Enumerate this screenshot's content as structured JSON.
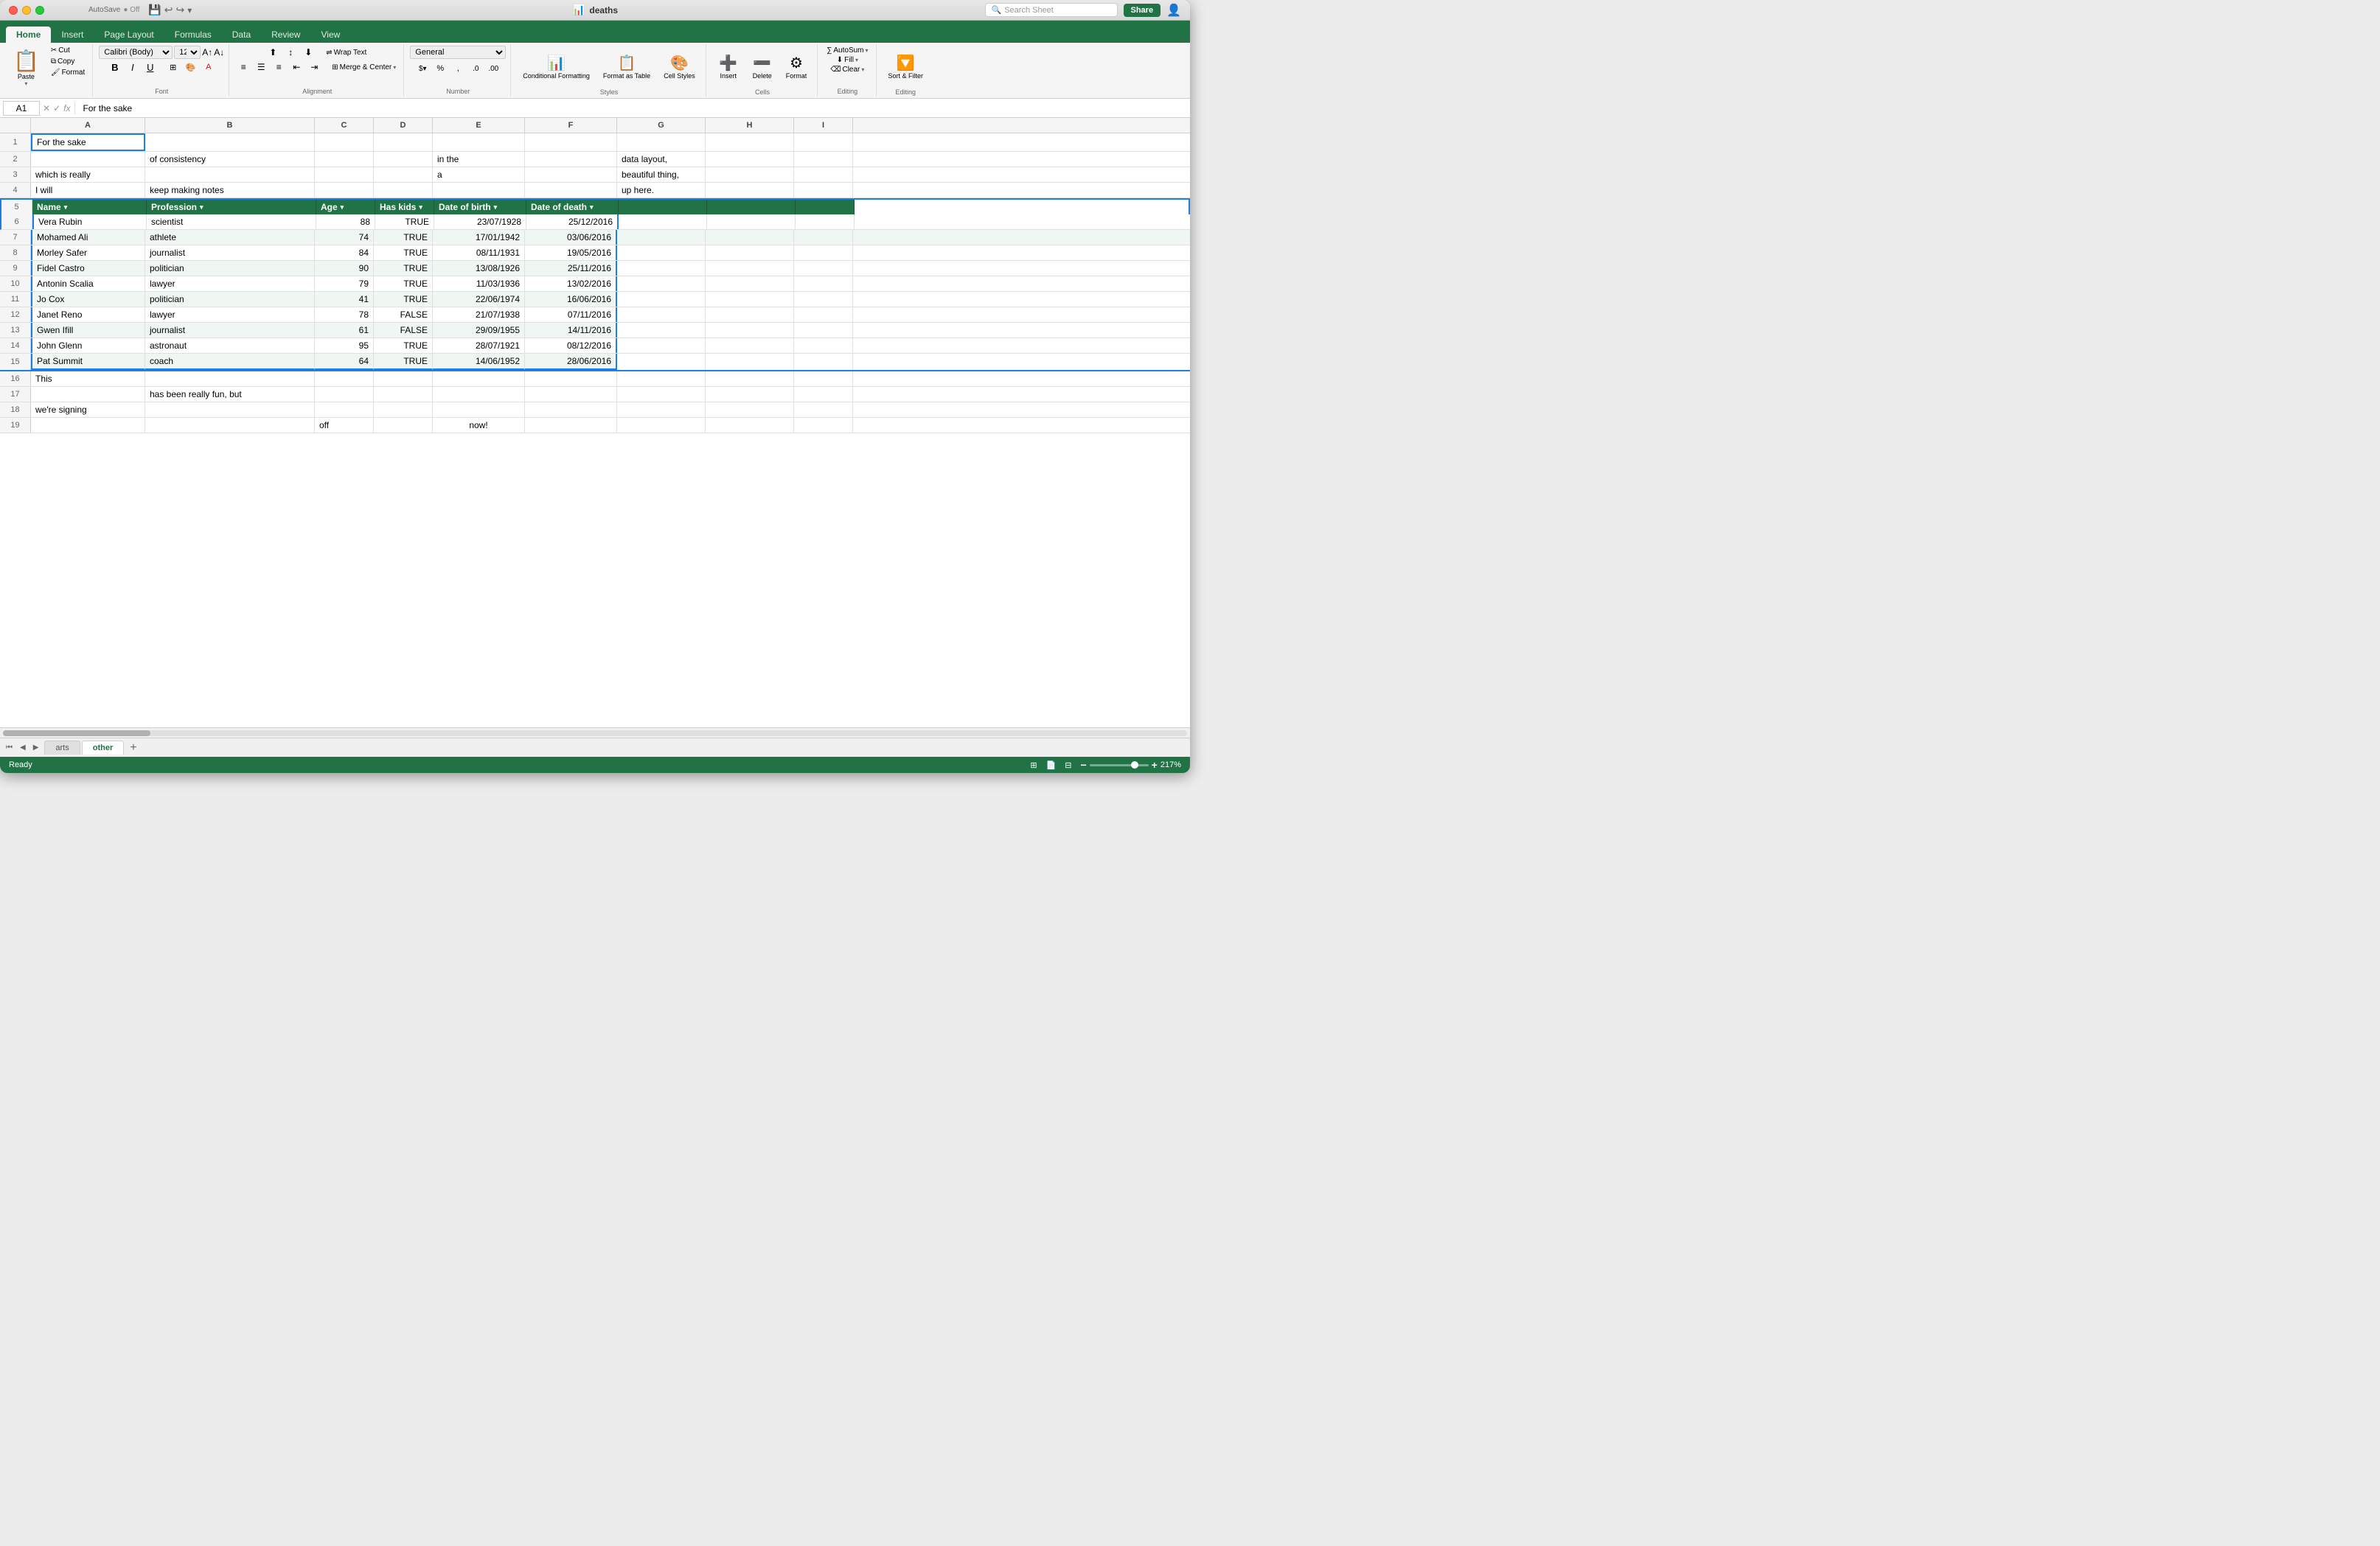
{
  "window": {
    "title": "deaths",
    "autosave": "AutoSave",
    "autosave_status": "Off"
  },
  "titlebar": {
    "search_placeholder": "Search Sheet",
    "share_label": "Share"
  },
  "ribbon": {
    "tabs": [
      "Home",
      "Insert",
      "Page Layout",
      "Formulas",
      "Data",
      "Review",
      "View"
    ],
    "active_tab": "Home",
    "paste_label": "Paste",
    "cut_label": "Cut",
    "copy_label": "Copy",
    "format_label": "Format",
    "font_name": "Calibri (Body)",
    "font_size": "12",
    "bold_label": "B",
    "italic_label": "I",
    "underline_label": "U",
    "wrap_text_label": "Wrap Text",
    "merge_label": "Merge & Center",
    "number_format": "General",
    "conditional_formatting_label": "Conditional Formatting",
    "format_as_table_label": "Format as Table",
    "cell_styles_label": "Cell Styles",
    "insert_label": "Insert",
    "delete_label": "Delete",
    "format_cells_label": "Format",
    "autosum_label": "AutoSum",
    "fill_label": "Fill",
    "clear_label": "Clear",
    "sort_filter_label": "Sort & Filter"
  },
  "formula_bar": {
    "cell_ref": "A1",
    "formula": "For the sake"
  },
  "columns": [
    "A",
    "B",
    "C",
    "D",
    "E",
    "F",
    "G",
    "H",
    "I"
  ],
  "rows": [
    {
      "num": 1,
      "cells": [
        "For the sake",
        "",
        "",
        "",
        "",
        "",
        "",
        "",
        ""
      ],
      "selected": true
    },
    {
      "num": 2,
      "cells": [
        "",
        "of consistency",
        "",
        "",
        "in the",
        "",
        "data layout,",
        "",
        ""
      ]
    },
    {
      "num": 3,
      "cells": [
        "which is really",
        "",
        "",
        "",
        "a",
        "",
        "beautiful thing,",
        "",
        ""
      ]
    },
    {
      "num": 4,
      "cells": [
        "I will",
        "",
        "keep making notes",
        "",
        "",
        "",
        "up here.",
        "",
        ""
      ]
    },
    {
      "num": 5,
      "cells": [
        "Name",
        "Profession",
        "Age",
        "Has kids",
        "Date of birth",
        "Date of death",
        "",
        "",
        ""
      ],
      "is_table_header": true
    },
    {
      "num": 6,
      "cells": [
        "Vera Rubin",
        "scientist",
        "88",
        "TRUE",
        "23/07/1928",
        "25/12/2016",
        "",
        "",
        ""
      ],
      "is_table_data": true,
      "row_index": 0
    },
    {
      "num": 7,
      "cells": [
        "Mohamed Ali",
        "athlete",
        "74",
        "TRUE",
        "17/01/1942",
        "03/06/2016",
        "",
        "",
        ""
      ],
      "is_table_data": true,
      "row_index": 1
    },
    {
      "num": 8,
      "cells": [
        "Morley Safer",
        "journalist",
        "84",
        "TRUE",
        "08/11/1931",
        "19/05/2016",
        "",
        "",
        ""
      ],
      "is_table_data": true,
      "row_index": 2
    },
    {
      "num": 9,
      "cells": [
        "Fidel Castro",
        "politician",
        "90",
        "TRUE",
        "13/08/1926",
        "25/11/2016",
        "",
        "",
        ""
      ],
      "is_table_data": true,
      "row_index": 3
    },
    {
      "num": 10,
      "cells": [
        "Antonin Scalia",
        "lawyer",
        "79",
        "TRUE",
        "11/03/1936",
        "13/02/2016",
        "",
        "",
        ""
      ],
      "is_table_data": true,
      "row_index": 4
    },
    {
      "num": 11,
      "cells": [
        "Jo Cox",
        "politician",
        "41",
        "TRUE",
        "22/06/1974",
        "16/06/2016",
        "",
        "",
        ""
      ],
      "is_table_data": true,
      "row_index": 5
    },
    {
      "num": 12,
      "cells": [
        "Janet Reno",
        "lawyer",
        "78",
        "FALSE",
        "21/07/1938",
        "07/11/2016",
        "",
        "",
        ""
      ],
      "is_table_data": true,
      "row_index": 6
    },
    {
      "num": 13,
      "cells": [
        "Gwen Ifill",
        "journalist",
        "61",
        "FALSE",
        "29/09/1955",
        "14/11/2016",
        "",
        "",
        ""
      ],
      "is_table_data": true,
      "row_index": 7
    },
    {
      "num": 14,
      "cells": [
        "John Glenn",
        "astronaut",
        "95",
        "TRUE",
        "28/07/1921",
        "08/12/2016",
        "",
        "",
        ""
      ],
      "is_table_data": true,
      "row_index": 8
    },
    {
      "num": 15,
      "cells": [
        "Pat Summit",
        "coach",
        "64",
        "TRUE",
        "14/06/1952",
        "28/06/2016",
        "",
        "",
        ""
      ],
      "is_table_data": true,
      "row_index": 9
    },
    {
      "num": 16,
      "cells": [
        "This",
        "",
        "",
        "",
        "",
        "",
        "",
        "",
        ""
      ]
    },
    {
      "num": 17,
      "cells": [
        "",
        "has been really fun, but",
        "",
        "",
        "",
        "",
        "",
        "",
        ""
      ]
    },
    {
      "num": 18,
      "cells": [
        "we're signing",
        "",
        "",
        "",
        "",
        "",
        "",
        "",
        ""
      ]
    },
    {
      "num": 19,
      "cells": [
        "",
        "",
        "off",
        "",
        "",
        "now!",
        "",
        "",
        ""
      ]
    }
  ],
  "sheets": [
    "arts",
    "other"
  ],
  "active_sheet": "other",
  "status": {
    "ready_label": "Ready",
    "zoom": "217%"
  },
  "table_headers": {
    "name": "Name",
    "profession": "Profession",
    "age": "Age",
    "has_kids": "Has kids",
    "dob": "Date of birth",
    "dod": "Date of death"
  }
}
